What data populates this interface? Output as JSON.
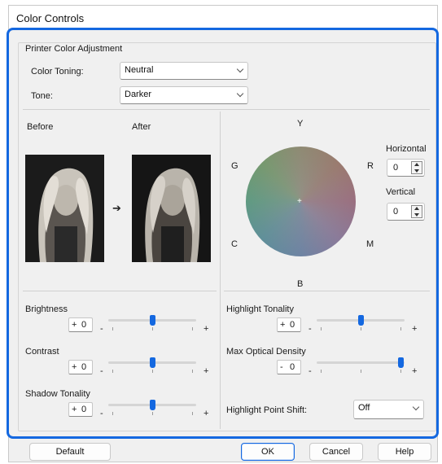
{
  "window": {
    "title": "Color Controls"
  },
  "group": {
    "legend": "Printer Color Adjustment"
  },
  "color_toning": {
    "label": "Color Toning:",
    "value": "Neutral"
  },
  "tone": {
    "label": "Tone:",
    "value": "Darker"
  },
  "preview": {
    "before_label": "Before",
    "after_label": "After"
  },
  "wheel": {
    "labels": {
      "y": "Y",
      "g": "G",
      "r": "R",
      "c": "C",
      "m": "M",
      "b": "B"
    },
    "horizontal": {
      "label": "Horizontal",
      "value": "0"
    },
    "vertical": {
      "label": "Vertical",
      "value": "0"
    }
  },
  "sliders": {
    "brightness": {
      "label": "Brightness",
      "sign": "+",
      "value": "0",
      "minus": "-",
      "plus": "+",
      "level": 0.5
    },
    "contrast": {
      "label": "Contrast",
      "sign": "+",
      "value": "0",
      "minus": "-",
      "plus": "+",
      "level": 0.5
    },
    "shadow_tonality": {
      "label": "Shadow Tonality",
      "sign": "+",
      "value": "0",
      "minus": "-",
      "plus": "+",
      "level": 0.5
    },
    "highlight_tonality": {
      "label": "Highlight Tonality",
      "sign": "+",
      "value": "0",
      "minus": "-",
      "plus": "+",
      "level": 0.5
    },
    "max_optical_density": {
      "label": "Max Optical Density",
      "sign": "-",
      "value": "0",
      "minus": "-",
      "plus": "+",
      "level": 1.0
    }
  },
  "highlight_point_shift": {
    "label": "Highlight Point Shift:",
    "value": "Off"
  },
  "buttons": {
    "default": "Default",
    "ok": "OK",
    "cancel": "Cancel",
    "help": "Help"
  },
  "colors": {
    "accent": "#1468e0",
    "background": "#f0f0f0"
  }
}
